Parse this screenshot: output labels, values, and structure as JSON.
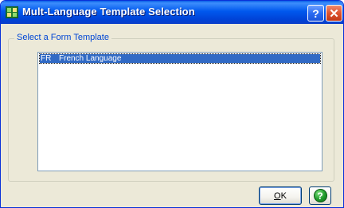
{
  "window": {
    "title": "Mult-Language Template Selection",
    "help_glyph": "?",
    "close_glyph": "✕",
    "icons": {
      "app": "app-icon",
      "help": "help-icon",
      "close": "close-icon"
    }
  },
  "group": {
    "label": "Select a Form Template"
  },
  "list": {
    "items": [
      {
        "code": "FR",
        "description": "French Language",
        "selected": true
      }
    ]
  },
  "buttons": {
    "ok_prefix": "",
    "ok_underlined": "O",
    "ok_rest": "K",
    "help_glyph": "?"
  },
  "colors": {
    "title_bar": "#0058ee",
    "selection": "#316ac5",
    "group_label": "#0046d5",
    "help_green": "#1f9a2a"
  }
}
